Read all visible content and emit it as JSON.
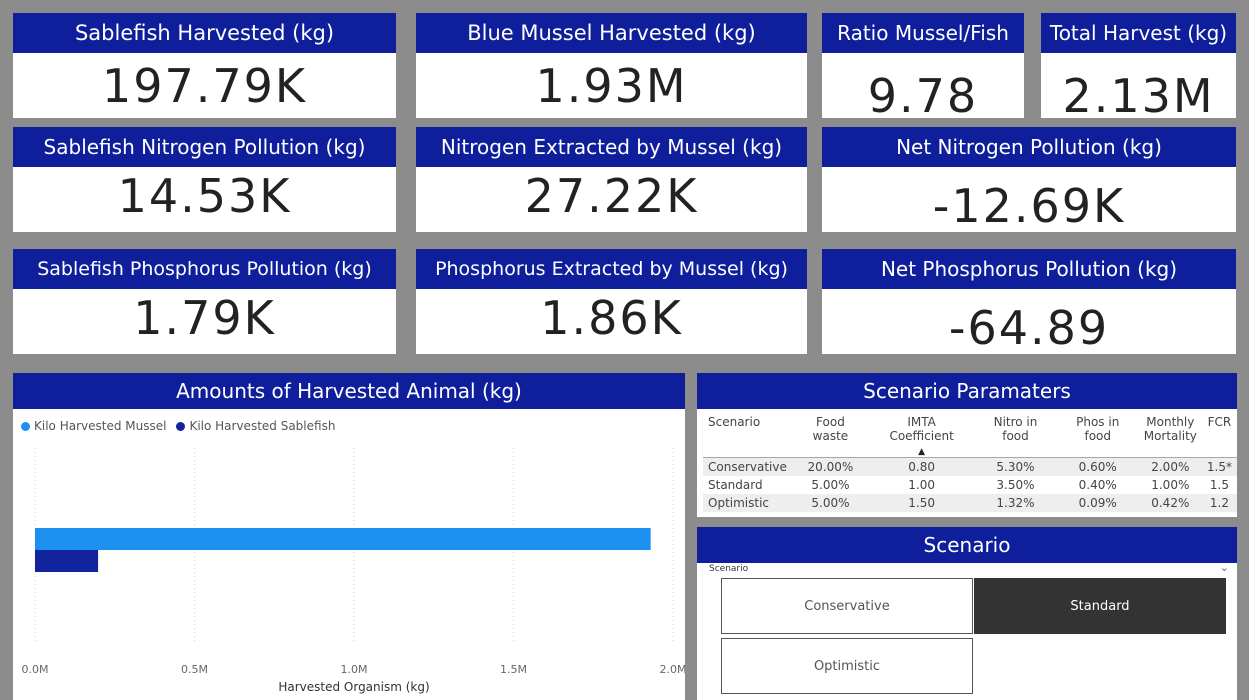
{
  "kpis": {
    "sablefish_harvested": {
      "title": "Sablefish Harvested (kg)",
      "value": "197.79K"
    },
    "mussel_harvested": {
      "title": "Blue Mussel Harvested (kg)",
      "value": "1.93M"
    },
    "ratio": {
      "title": "Ratio Mussel/Fish",
      "value": "9.78"
    },
    "total_harvest": {
      "title": "Total Harvest (kg)",
      "value": "2.13M"
    },
    "sablefish_nitrogen": {
      "title": "Sablefish Nitrogen Pollution (kg)",
      "value": "14.53K"
    },
    "nitrogen_extracted": {
      "title": "Nitrogen Extracted by Mussel (kg)",
      "value": "27.22K"
    },
    "net_nitrogen": {
      "title": "Net Nitrogen Pollution (kg)",
      "value": "-12.69K"
    },
    "sablefish_phosphorus": {
      "title": "Sablefish Phosphorus Pollution (kg)",
      "value": "1.79K"
    },
    "phosphorus_extracted": {
      "title": "Phosphorus Extracted by Mussel (kg)",
      "value": "1.86K"
    },
    "net_phosphorus": {
      "title": "Net Phosphorus Pollution (kg)",
      "value": "-64.89"
    }
  },
  "harvest_chart": {
    "title": "Amounts of Harvested Animal (kg)",
    "legend": [
      {
        "label": "Kilo Harvested Mussel",
        "color": "#1e90f0"
      },
      {
        "label": "Kilo Harvested Sablefish",
        "color": "#12239e"
      }
    ]
  },
  "chart_data": {
    "type": "bar",
    "orientation": "horizontal",
    "title": "Amounts of Harvested Animal (kg)",
    "xlabel": "Harvested Organism (kg)",
    "ylabel": "",
    "xlim": [
      0,
      2000000
    ],
    "ticks": [
      {
        "value": 0,
        "label": "0.0M"
      },
      {
        "value": 500000,
        "label": "0.5M"
      },
      {
        "value": 1000000,
        "label": "1.0M"
      },
      {
        "value": 1500000,
        "label": "1.5M"
      },
      {
        "value": 2000000,
        "label": "2.0M"
      }
    ],
    "series": [
      {
        "name": "Kilo Harvested Mussel",
        "values": [
          1930000
        ],
        "color": "#1e90f0"
      },
      {
        "name": "Kilo Harvested Sablefish",
        "values": [
          197790
        ],
        "color": "#12239e"
      }
    ],
    "grid": true,
    "legend_position": "top-left"
  },
  "params_table": {
    "title": "Scenario Paramaters",
    "headers": [
      "Scenario",
      "Food waste",
      "IMTA Coefficient",
      "Nitro in food",
      "Phos in food",
      "Monthly Mortality",
      "FCR"
    ],
    "sort_icon": "▲",
    "rows": [
      [
        "Conservative",
        "20.00%",
        "0.80",
        "5.30%",
        "0.60%",
        "2.00%",
        "1.5*"
      ],
      [
        "Standard",
        "5.00%",
        "1.00",
        "3.50%",
        "0.40%",
        "1.00%",
        "1.5"
      ],
      [
        "Optimistic",
        "5.00%",
        "1.50",
        "1.32%",
        "0.09%",
        "0.42%",
        "1.2"
      ]
    ]
  },
  "slicer": {
    "title": "Scenario",
    "field_label": "Scenario",
    "options": [
      "Conservative",
      "Standard",
      "Optimistic"
    ],
    "selected": "Standard"
  }
}
